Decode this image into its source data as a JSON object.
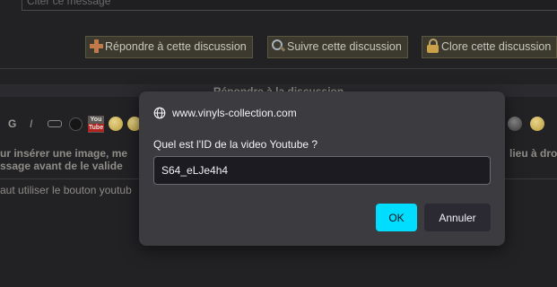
{
  "page": {
    "quote_placeholder": "Citer ce message",
    "buttons": {
      "reply": "Répondre à cette discussion",
      "follow": "Suivre cette discussion",
      "close": "Clore cette discussion"
    },
    "reply_header": "Répondre à la discussion",
    "toolbar": {
      "bold": "G",
      "italic": "I",
      "youtube_top": "You",
      "youtube_bottom": "Tube"
    },
    "body_text": {
      "line1": "ur insérer une image, me",
      "line2": "ssage avant de le valide",
      "line3": "aut utiliser le bouton youtub",
      "right1": "lieu à droi"
    }
  },
  "dialog": {
    "origin": "www.vinyls-collection.com",
    "message": "Quel est l'ID de la video Youtube ?",
    "input_value": "S64_eLJe4h4",
    "ok_label": "OK",
    "cancel_label": "Annuler"
  },
  "colors": {
    "accent": "#00ddff",
    "dialog_bg": "#3c3b40",
    "page_bg": "#222124"
  }
}
